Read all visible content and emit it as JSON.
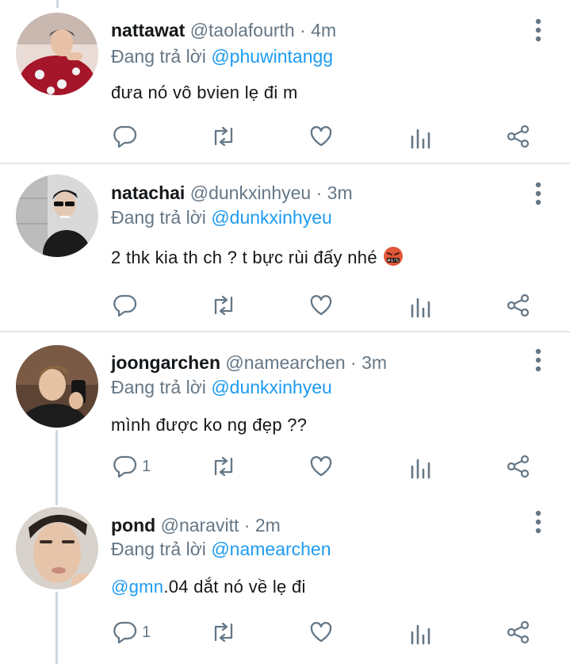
{
  "tweets": [
    {
      "display_name": "nattawat",
      "handle": "@taolafourth",
      "time": "· 4m",
      "reply_prefix": "Đang trả lời",
      "reply_to": "@phuwintangg",
      "text": "đưa nó vô bvien lẹ đi m",
      "reply_count": ""
    },
    {
      "display_name": "natachai",
      "handle": "@dunkxinhyeu",
      "time": "· 3m",
      "reply_prefix": "Đang trả lời",
      "reply_to": "@dunkxinhyeu",
      "text": "2 thk kia th ch ? t bực rùi đấy nhé",
      "emoji": "angry-swearing-face-icon",
      "reply_count": ""
    },
    {
      "display_name": "joongarchen",
      "handle": "@namearchen",
      "time": "· 3m",
      "reply_prefix": "Đang trả lời",
      "reply_to": "@dunkxinhyeu",
      "text": "mình được ko ng đẹp ??",
      "reply_count": "1"
    },
    {
      "display_name": "pond",
      "handle": "@naravitt",
      "time": "· 2m",
      "reply_prefix": "Đang trả lời",
      "reply_to": "@namearchen",
      "text_mention": "@gmn",
      "text": ".04 dắt nó về lẹ đi",
      "reply_count": "1"
    }
  ],
  "icons": [
    "reply-icon",
    "retweet-icon",
    "like-icon",
    "analytics-icon",
    "share-icon",
    "more-options-icon"
  ],
  "colors": {
    "link": "#1d9bf0",
    "muted": "#657786",
    "text": "#14171a",
    "thread_line": "#cfd9de"
  }
}
